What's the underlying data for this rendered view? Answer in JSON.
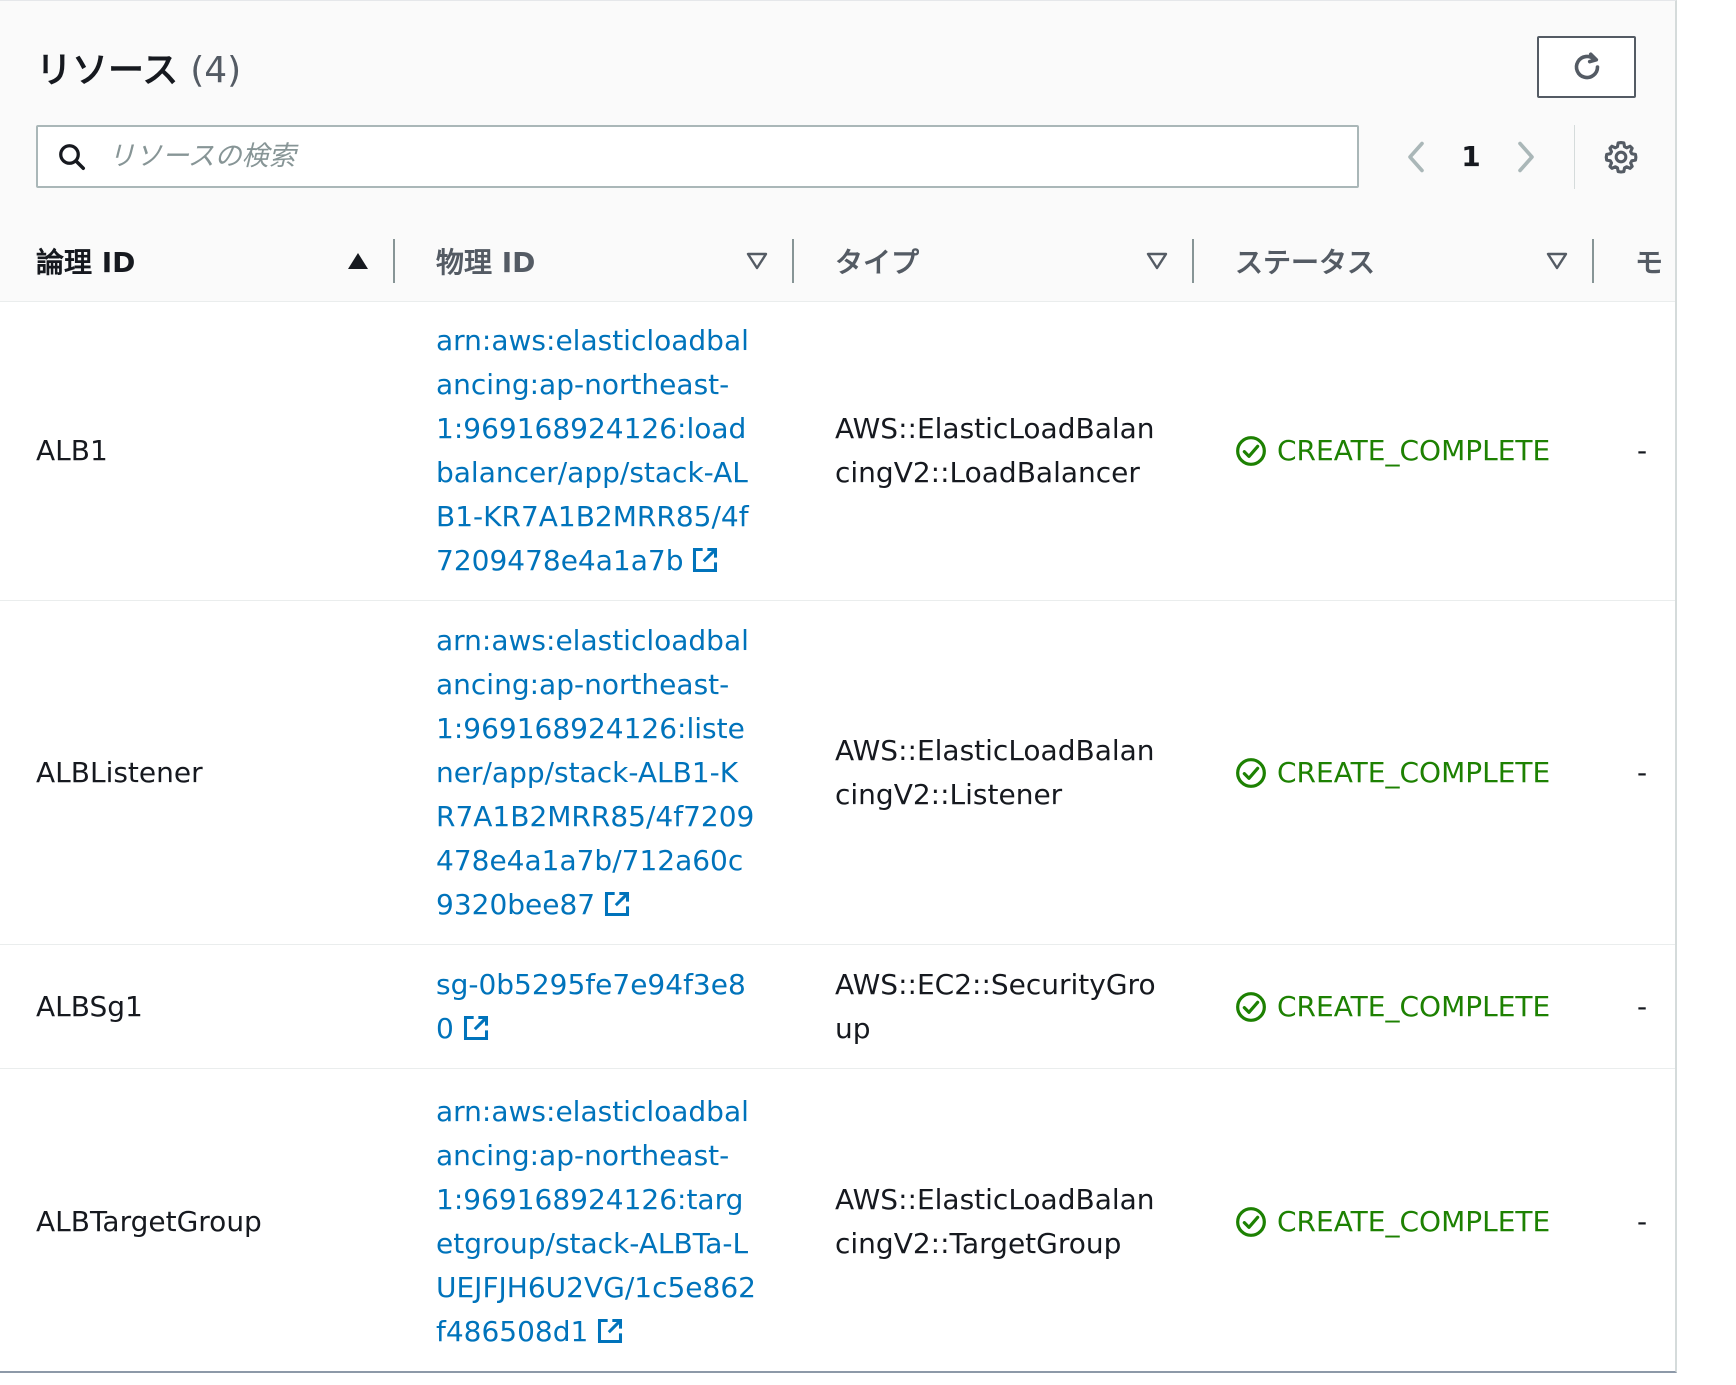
{
  "header": {
    "title": "リソース",
    "count": "(4)"
  },
  "search": {
    "placeholder": "リソースの検索",
    "value": ""
  },
  "pagination": {
    "current_page": "1"
  },
  "columns": [
    {
      "label": "論理 ID",
      "sort": "ascending"
    },
    {
      "label": "物理 ID",
      "sort": "none"
    },
    {
      "label": "タイプ",
      "sort": "none"
    },
    {
      "label": "ステータス",
      "sort": "none"
    },
    {
      "label": "モ",
      "sort": "none"
    }
  ],
  "rows": [
    {
      "logical_id": "ALB1",
      "physical_id": "arn:aws:elasticloadbalancing:ap-northeast-1:969168924126:loadbalancer/app/stack-ALB1-KR7A1B2MRR85/4f7209478e4a1a7b",
      "type": "AWS::ElasticLoadBalancingV2::LoadBalancer",
      "status": "CREATE_COMPLETE",
      "module": "-"
    },
    {
      "logical_id": "ALBListener",
      "physical_id": "arn:aws:elasticloadbalancing:ap-northeast-1:969168924126:listener/app/stack-ALB1-KR7A1B2MRR85/4f7209478e4a1a7b/712a60c9320bee87",
      "type": "AWS::ElasticLoadBalancingV2::Listener",
      "status": "CREATE_COMPLETE",
      "module": "-"
    },
    {
      "logical_id": "ALBSg1",
      "physical_id": "sg-0b5295fe7e94f3e80",
      "type": "AWS::EC2::SecurityGroup",
      "status": "CREATE_COMPLETE",
      "module": "-"
    },
    {
      "logical_id": "ALBTargetGroup",
      "physical_id": "arn:aws:elasticloadbalancing:ap-northeast-1:969168924126:targetgroup/stack-ALBTa-LUEJFJH6U2VG/1c5e862f486508d1",
      "type": "AWS::ElasticLoadBalancingV2::TargetGroup",
      "status": "CREATE_COMPLETE",
      "module": "-"
    }
  ],
  "colors": {
    "link": "#0073bb",
    "success": "#1d8102",
    "text": "#16191f",
    "muted": "#545b64"
  },
  "icons": {
    "refresh": "refresh-icon",
    "search": "search-icon",
    "prev": "chevron-left-icon",
    "next": "chevron-right-icon",
    "settings": "gear-icon",
    "external": "external-link-icon",
    "status": "check-circle-icon",
    "sort_asc": "caret-up-icon",
    "sort_none": "caret-down-outline-icon"
  }
}
